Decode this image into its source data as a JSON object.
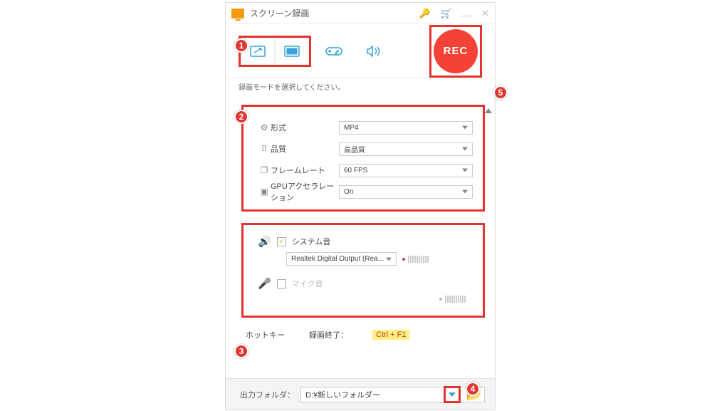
{
  "titlebar": {
    "title": "スクリーン録画"
  },
  "mode": {
    "hint": "録画モードを選択してください。",
    "rec_label": "REC"
  },
  "settings": {
    "format": {
      "label": "形式",
      "value": "MP4"
    },
    "quality": {
      "label": "品質",
      "value": "高品質"
    },
    "framerate": {
      "label": "フレームレート",
      "value": "60 FPS"
    },
    "gpu": {
      "label": "GPUアクセラレーション",
      "value": "On"
    }
  },
  "audio": {
    "system": {
      "label": "システム音",
      "checked": true,
      "device": "Realtek Digital Output (Rea..."
    },
    "mic": {
      "label": "マイク音",
      "checked": false
    }
  },
  "hotkey": {
    "label": "ホットキー",
    "stop_label": "録画終了：",
    "stop_value": "Ctrl + F1"
  },
  "output": {
    "label": "出力フォルダ：",
    "path": "D:¥新しいフォルダー"
  },
  "annotations": {
    "a1": "1",
    "a2": "2",
    "a3": "3",
    "a4": "4",
    "a5": "5"
  }
}
